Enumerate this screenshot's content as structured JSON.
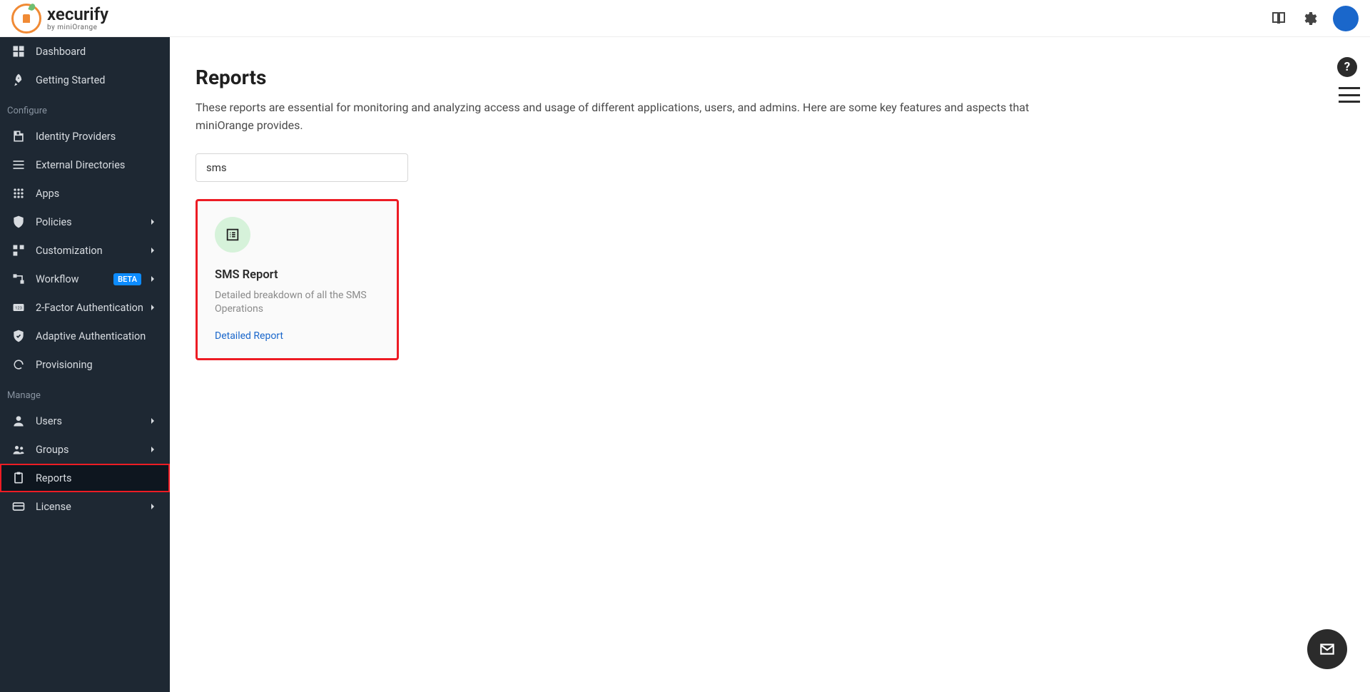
{
  "brand": {
    "name": "xecurify",
    "sub": "by miniOrange"
  },
  "sidebar": {
    "items": [
      {
        "label": "Dashboard"
      },
      {
        "label": "Getting Started"
      }
    ],
    "section_configure": "Configure",
    "configure": [
      {
        "label": "Identity Providers"
      },
      {
        "label": "External Directories"
      },
      {
        "label": "Apps"
      },
      {
        "label": "Policies",
        "chevron": true
      },
      {
        "label": "Customization",
        "chevron": true
      },
      {
        "label": "Workflow",
        "badge": "BETA",
        "chevron": true
      },
      {
        "label": "2-Factor Authentication",
        "chevron": true
      },
      {
        "label": "Adaptive Authentication"
      },
      {
        "label": "Provisioning"
      }
    ],
    "section_manage": "Manage",
    "manage": [
      {
        "label": "Users",
        "chevron": true
      },
      {
        "label": "Groups",
        "chevron": true
      },
      {
        "label": "Reports",
        "active": true
      },
      {
        "label": "License",
        "chevron": true
      }
    ]
  },
  "page": {
    "title": "Reports",
    "description": "These reports are essential for monitoring and analyzing access and usage of different applications, users, and admins. Here are some key features and aspects that miniOrange provides.",
    "search_value": "sms"
  },
  "card": {
    "title": "SMS Report",
    "desc": "Detailed breakdown of all the SMS Operations",
    "link": "Detailed Report"
  }
}
